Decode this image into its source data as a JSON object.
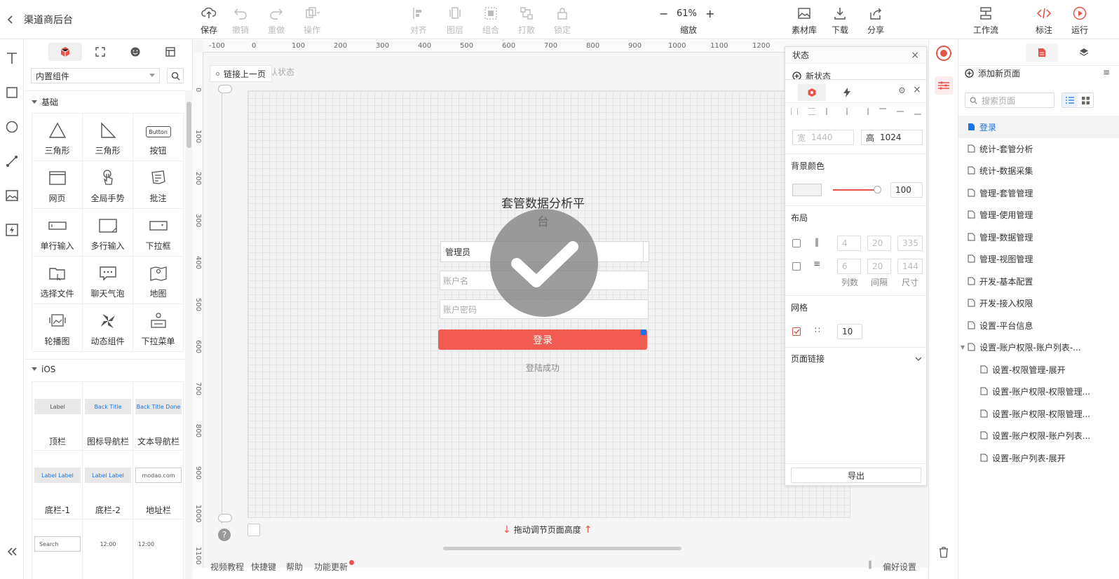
{
  "app": {
    "back_title": "渠道商后台"
  },
  "toolbar": {
    "save": "保存",
    "undo": "撤销",
    "redo": "重做",
    "operate": "操作",
    "align": "对齐",
    "layer": "图层",
    "group": "组合",
    "ungroup": "打散",
    "lock": "锁定",
    "zoom_value": "61%",
    "zoom_label": "缩放",
    "zoom_minus": "−",
    "zoom_plus": "+",
    "assets": "素材库",
    "download": "下载",
    "share": "分享",
    "workflow": "工作流",
    "annotate": "标注",
    "run": "运行"
  },
  "components": {
    "source_select": "内置组件",
    "section_basic": "基础",
    "basic_items": [
      "三角形",
      "三角形",
      "按钮",
      "网页",
      "全局手势",
      "批注",
      "单行输入",
      "多行输入",
      "下拉框",
      "选择文件",
      "聊天气泡",
      "地图",
      "轮播图",
      "动态组件",
      "下拉菜单"
    ],
    "button_preview": "Button",
    "section_ios": "iOS",
    "ios_items": [
      "顶栏",
      "图标导航栏",
      "文本导航栏",
      "底栏-1",
      "底栏-2",
      "地址栏"
    ],
    "ios_previews": [
      "Label",
      "Back  Title",
      "Back Title Done",
      "Label  Label",
      "Label  Label",
      "modao.com",
      "Search",
      "12:00",
      "12:00"
    ]
  },
  "ruler": {
    "h": [
      "-100",
      "0",
      "100",
      "200",
      "300",
      "400",
      "500",
      "600",
      "700",
      "800",
      "900",
      "1000",
      "1100",
      "1200"
    ],
    "v": [
      "0",
      "100",
      "200",
      "300",
      "400",
      "500",
      "600",
      "700",
      "800",
      "900",
      "1000",
      "1100"
    ]
  },
  "canvas": {
    "link_prev": "链接上一页",
    "state_label": "默认状态",
    "title": "套管数据分析平台",
    "role_select": "管理员",
    "username_placeholder": "账户名",
    "password_placeholder": "账户密码",
    "login_button": "登录",
    "success_text": "登陆成功",
    "drag_hint": "拖动调节页面高度",
    "help_mark": "?"
  },
  "state_panel": {
    "title": "状态",
    "new_state": "新状态"
  },
  "props": {
    "width_label": "宽",
    "width_value": "1440",
    "height_label": "高",
    "height_value": "1024",
    "bg_title": "背景颜色",
    "opacity": "100",
    "layout_title": "布局",
    "layout_row1": [
      "4",
      "20",
      "335"
    ],
    "layout_row2": [
      "6",
      "20",
      "144"
    ],
    "layout_labels": [
      "列数",
      "间隔",
      "尺寸"
    ],
    "grid_title": "网格",
    "grid_value": "10",
    "page_link": "页面链接",
    "export": "导出",
    "accent": "#e5534b"
  },
  "pages": {
    "add_page": "添加新页面",
    "search_placeholder": "搜索页面",
    "items": [
      "登录",
      "统计-套管分析",
      "统计-数据采集",
      "管理-套管管理",
      "管理-使用管理",
      "管理-数据管理",
      "管理-视图管理",
      "开发-基本配置",
      "开发-接入权限",
      "设置-平台信息",
      "设置-账户权限-账户列表-...",
      "设置-权限管理-展开",
      "设置-账户权限-权限管理...",
      "设置-账户权限-权限管理...",
      "设置-账户权限-账户列表...",
      "设置-账户列表-展开"
    ]
  },
  "bottom": {
    "video": "视频教程",
    "shortcut": "快捷键",
    "help": "帮助",
    "update": "功能更新",
    "prefs": "偏好设置"
  }
}
